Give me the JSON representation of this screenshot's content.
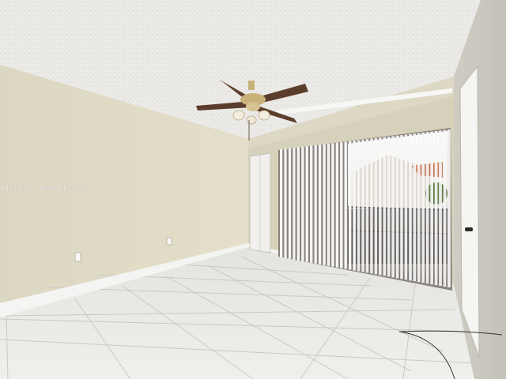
{
  "photo": {
    "watermark": "A1169775 © Miami MLS 2025"
  },
  "colors": {
    "ceiling": "#ecebe8",
    "wall_left": "#ddd8c2",
    "wall_back": "#d6d1ba",
    "wall_right": "#d2d0c6",
    "floor_tile": "#e9e9e6",
    "baseboard": "#f4f4f2",
    "blinds": "#f6f6f6",
    "fan_blade": "#5b3d2c",
    "fan_brass": "#c8b27a"
  },
  "scene_objects": [
    "ceiling-fan",
    "vertical-blinds",
    "sliding-glass-door",
    "closet-door",
    "entry-door",
    "tile-floor",
    "textured-ceiling",
    "electrical-outlet"
  ]
}
